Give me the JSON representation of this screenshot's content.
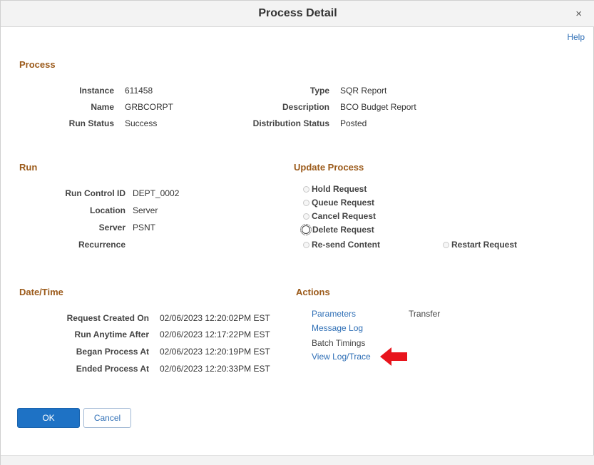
{
  "dialog": {
    "title": "Process Detail",
    "close_glyph": "×",
    "help_label": "Help"
  },
  "process": {
    "section_title": "Process",
    "instance_label": "Instance",
    "instance_value": "611458",
    "name_label": "Name",
    "name_value": "GRBCORPT",
    "run_status_label": "Run Status",
    "run_status_value": "Success",
    "type_label": "Type",
    "type_value": "SQR Report",
    "description_label": "Description",
    "description_value": "BCO Budget Report",
    "distribution_status_label": "Distribution Status",
    "distribution_status_value": "Posted"
  },
  "run": {
    "section_title": "Run",
    "run_control_id_label": "Run Control ID",
    "run_control_id_value": "DEPT_0002",
    "location_label": "Location",
    "location_value": "Server",
    "server_label": "Server",
    "server_value": "PSNT",
    "recurrence_label": "Recurrence"
  },
  "update_process": {
    "section_title": "Update Process",
    "options": [
      "Hold Request",
      "Queue Request",
      "Cancel Request",
      "Delete Request",
      "Re-send Content",
      "Restart Request"
    ]
  },
  "datetime": {
    "section_title": "Date/Time",
    "request_created_label": "Request Created On",
    "request_created_value": "02/06/2023 12:20:02PM EST",
    "run_anytime_label": "Run Anytime After",
    "run_anytime_value": "02/06/2023 12:17:22PM EST",
    "began_label": "Began Process At",
    "began_value": "02/06/2023 12:20:19PM EST",
    "ended_label": "Ended Process At",
    "ended_value": "02/06/2023 12:20:33PM EST"
  },
  "actions": {
    "section_title": "Actions",
    "parameters": "Parameters",
    "transfer": "Transfer",
    "message_log": "Message Log",
    "batch_timings": "Batch Timings",
    "view_log_trace": "View Log/Trace"
  },
  "buttons": {
    "ok": "OK",
    "cancel": "Cancel"
  },
  "annotation": {
    "arrow_color": "#e8141c",
    "arrow_icon": "left-arrow-icon"
  }
}
